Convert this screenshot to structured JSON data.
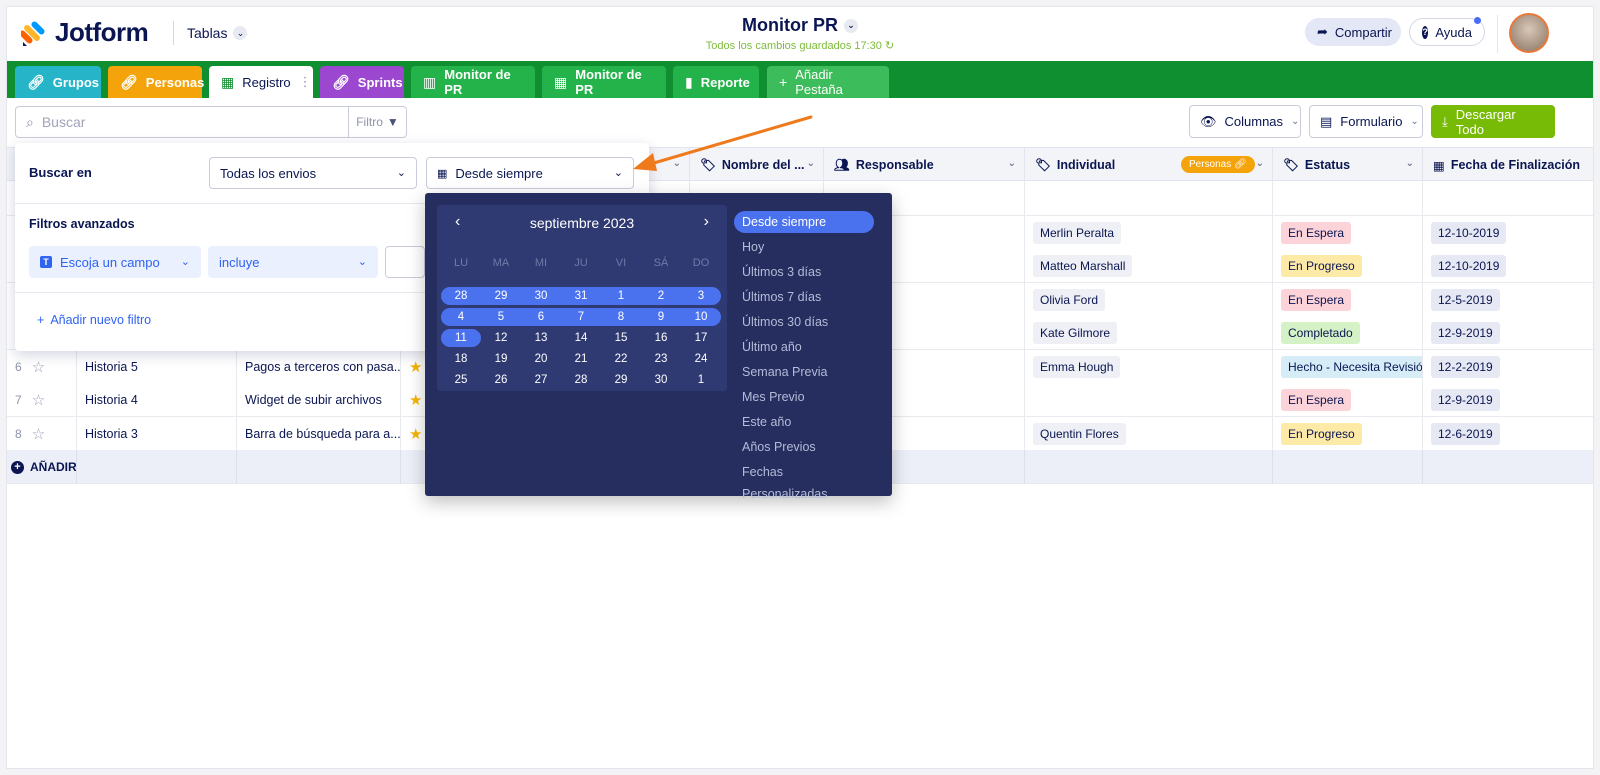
{
  "app": {
    "logo": "Jotform",
    "workspace": "Tablas",
    "title": "Monitor PR",
    "saved_status": "Todos los cambios guardados 17:30"
  },
  "header": {
    "share": "Compartir",
    "help": "Ayuda"
  },
  "tabs": [
    {
      "label": "Grupos",
      "color": "#26b5c8",
      "icon": "link-icon"
    },
    {
      "label": "Personas",
      "color": "#f5a30b",
      "icon": "link-icon"
    },
    {
      "label": "Registro",
      "color": "#ffffff",
      "icon": "table-icon"
    },
    {
      "label": "Sprints",
      "color": "#9b47d0",
      "icon": "link-icon"
    },
    {
      "label": "Monitor de PR",
      "color": "#23b34a",
      "icon": "board-icon"
    },
    {
      "label": "Monitor de PR",
      "color": "#23b34a",
      "icon": "calendar-icon"
    },
    {
      "label": "Reporte",
      "color": "#23b34a",
      "icon": "report-icon"
    },
    {
      "label": "Añadir Pestaña",
      "color": "#3dbc5b",
      "icon": "plus-icon"
    }
  ],
  "toolbar": {
    "search_placeholder": "Buscar",
    "filter": "Filtro",
    "columns": "Columnas",
    "form": "Formulario",
    "download": "Descargar Todo"
  },
  "columns": {
    "nombre": "Nombre del ...",
    "responsable": "Responsable",
    "individual": "Individual",
    "individual_badge": "Personas",
    "estatus": "Estatus",
    "fecha": "Fecha de Finalización"
  },
  "rows": [
    {
      "num": "",
      "col1": "",
      "col2": "",
      "star": false,
      "individual": "",
      "status": "",
      "status_color": "",
      "date": ""
    },
    {
      "num": "",
      "col1": "",
      "col2": "",
      "star": false,
      "individual": "Merlin Peralta",
      "status": "En Espera",
      "status_color": "red",
      "date": "12-10-2019"
    },
    {
      "num": "",
      "col1": "",
      "col2": "",
      "star": false,
      "individual": "Matteo Marshall",
      "status": "En Progreso",
      "status_color": "yellow",
      "date": "12-10-2019"
    },
    {
      "num": "",
      "col1": "",
      "col2": "",
      "star": false,
      "individual": "Olivia Ford",
      "status": "En Espera",
      "status_color": "red",
      "date": "12-5-2019"
    },
    {
      "num": "",
      "col1": "",
      "col2": "",
      "star": false,
      "individual": "Kate Gilmore",
      "status": "Completado",
      "status_color": "green",
      "date": "12-9-2019"
    },
    {
      "num": "6",
      "col1": "Historia 5",
      "col2": "Pagos a terceros con pasa...",
      "star": true,
      "individual": "Emma Hough",
      "status": "Hecho - Necesita Revisión",
      "status_color": "blue",
      "date": "12-2-2019"
    },
    {
      "num": "7",
      "col1": "Historia 4",
      "col2": "Widget de subir archivos",
      "star": true,
      "individual": "",
      "status": "En Espera",
      "status_color": "red",
      "date": "12-9-2019"
    },
    {
      "num": "8",
      "col1": "Historia 3",
      "col2": "Barra de búsqueda para a...",
      "star": true,
      "individual": "Quentin Flores",
      "status": "En Progreso",
      "status_color": "yellow",
      "date": "12-6-2019"
    }
  ],
  "add_row": "AÑADIR",
  "filter_panel": {
    "search_in": "Buscar en",
    "submissions": "Todas los envios",
    "date_range": "Desde siempre",
    "advanced": "Filtros avanzados",
    "field": "Escoja un campo",
    "operator": "incluye",
    "add_filter": "Añadir nuevo filtro"
  },
  "calendar": {
    "month": "septiembre 2023",
    "weekdays": [
      "LU",
      "MA",
      "MI",
      "JU",
      "VI",
      "SÁ",
      "DO"
    ],
    "weeks": [
      [
        "28",
        "29",
        "30",
        "31",
        "1",
        "2",
        "3"
      ],
      [
        "4",
        "5",
        "6",
        "7",
        "8",
        "9",
        "10"
      ],
      [
        "11",
        "12",
        "13",
        "14",
        "15",
        "16",
        "17"
      ],
      [
        "18",
        "19",
        "20",
        "21",
        "22",
        "23",
        "24"
      ],
      [
        "25",
        "26",
        "27",
        "28",
        "29",
        "30",
        "1"
      ]
    ],
    "presets": [
      "Desde siempre",
      "Hoy",
      "Últimos 3 días",
      "Últimos 7 días",
      "Últimos 30 días",
      "Último año",
      "Semana Previa",
      "Mes Previo",
      "Este año",
      "Años Previos",
      "Fechas Personalizadas"
    ],
    "active_preset": 0
  },
  "colors": {
    "brand_green": "#0f8f2f",
    "accent_blue": "#4a72ee",
    "download_green": "#78bb07",
    "picker_bg": "#252e5f",
    "arrow": "#ee7a1c"
  }
}
